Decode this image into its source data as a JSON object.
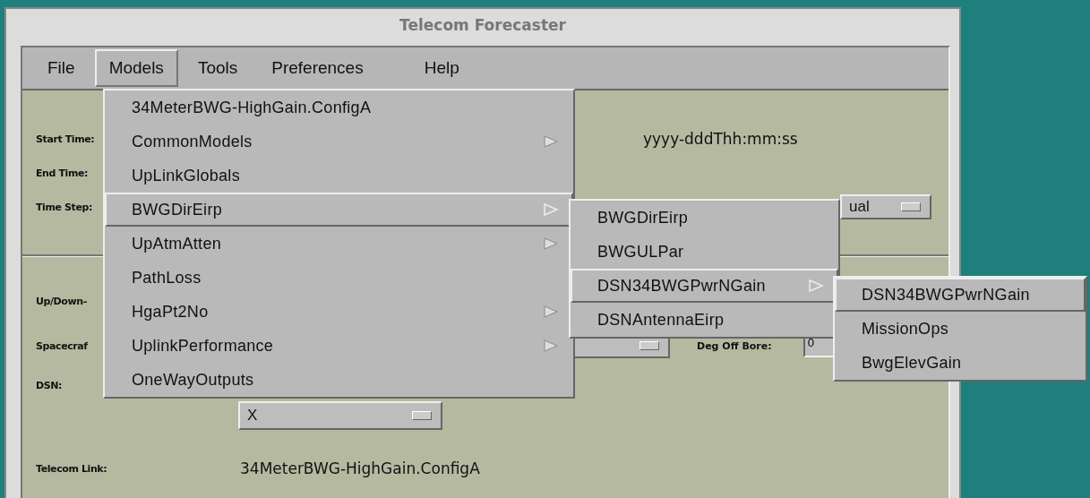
{
  "window": {
    "title": "Telecom Forecaster"
  },
  "menu_bar": [
    {
      "label": "File",
      "selected": false
    },
    {
      "label": "Models",
      "selected": true
    },
    {
      "label": "Tools",
      "selected": false
    },
    {
      "label": "Preferences",
      "selected": false
    },
    {
      "label": "Help",
      "selected": false
    }
  ],
  "form": {
    "start_time": {
      "label": "Start Time:",
      "format": "yyyy-dddThh:mm:ss"
    },
    "end_time": {
      "label": "End Time:"
    },
    "time_step": {
      "label": "Time Step:",
      "mode": "ual"
    },
    "up_down": {
      "label": "Up/Down-"
    },
    "spacecraft": {
      "label": "Spacecraf",
      "deg_off_bore_label": "Deg Off Bore:",
      "deg_off_bore": "0"
    },
    "dsn": {
      "label": "DSN:",
      "band": "X"
    },
    "telecom_link": {
      "label": "Telecom Link:",
      "value": "34MeterBWG-HighGain.ConfigA"
    }
  },
  "models_menu": {
    "items": [
      {
        "label": "34MeterBWG-HighGain.ConfigA",
        "has_submenu": false,
        "selected": false
      },
      {
        "label": "CommonModels",
        "has_submenu": true,
        "selected": false
      },
      {
        "label": "UpLinkGlobals",
        "has_submenu": false,
        "selected": false
      },
      {
        "label": "BWGDirEirp",
        "has_submenu": true,
        "selected": true
      },
      {
        "label": "UpAtmAtten",
        "has_submenu": true,
        "selected": false
      },
      {
        "label": "PathLoss",
        "has_submenu": false,
        "selected": false
      },
      {
        "label": "HgaPt2No",
        "has_submenu": true,
        "selected": false
      },
      {
        "label": "UplinkPerformance",
        "has_submenu": true,
        "selected": false
      },
      {
        "label": "OneWayOutputs",
        "has_submenu": false,
        "selected": false
      }
    ]
  },
  "submenu": {
    "items": [
      {
        "label": "BWGDirEirp",
        "has_submenu": false,
        "selected": false
      },
      {
        "label": "BWGULPar",
        "has_submenu": false,
        "selected": false
      },
      {
        "label": "DSN34BWGPwrNGain",
        "has_submenu": true,
        "selected": true
      },
      {
        "label": "DSNAntennaEirp",
        "has_submenu": false,
        "selected": false
      }
    ]
  },
  "submenu_2": {
    "items": [
      {
        "label": "DSN34BWGPwrNGain",
        "has_submenu": false,
        "selected": true
      },
      {
        "label": "MissionOps",
        "has_submenu": false,
        "selected": false
      },
      {
        "label": "BwgElevGain",
        "has_submenu": false,
        "selected": false
      }
    ]
  }
}
